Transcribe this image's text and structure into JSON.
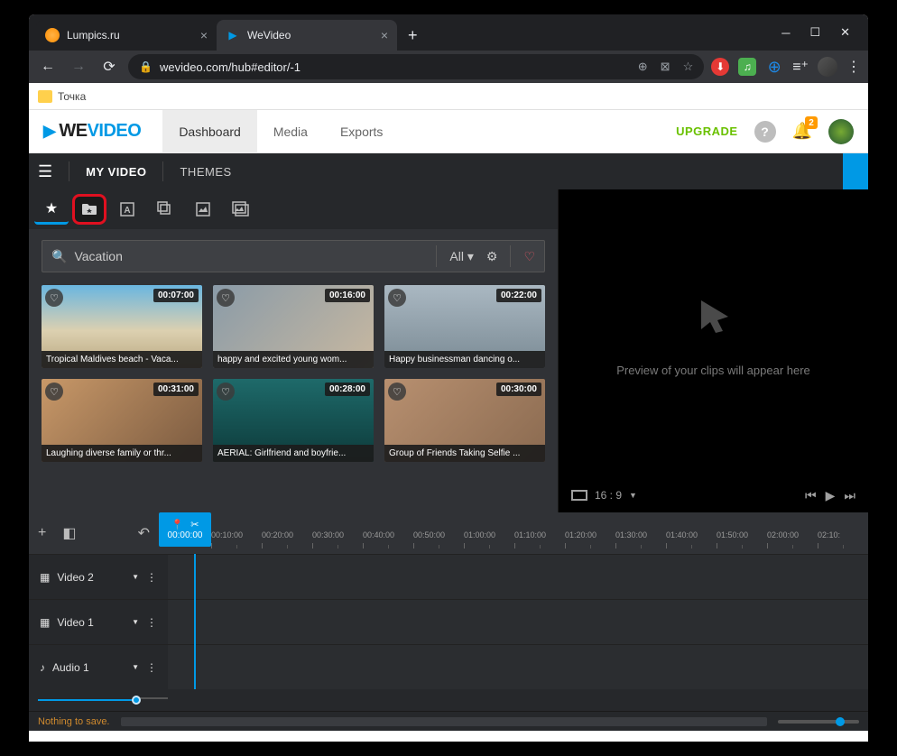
{
  "browser": {
    "tabs": [
      {
        "title": "Lumpics.ru",
        "active": false
      },
      {
        "title": "WeVideo",
        "active": true
      }
    ],
    "url_display": "wevideo.com/hub#editor/-1",
    "bookmark": "Точка"
  },
  "wevideo_nav": {
    "links": [
      "Dashboard",
      "Media",
      "Exports"
    ],
    "active": "Dashboard",
    "upgrade": "UPGRADE",
    "notif_count": "2"
  },
  "editor": {
    "tabs": [
      "MY VIDEO",
      "THEMES"
    ],
    "active": "MY VIDEO"
  },
  "search": {
    "value": "Vacation",
    "filter": "All"
  },
  "clips": [
    {
      "duration": "00:07:00",
      "title": "Tropical Maldives beach - Vaca...",
      "bg": "linear-gradient(180deg,#6ab6e0 0%,#dcd0b0 55%,#b8a680 100%)"
    },
    {
      "duration": "00:16:00",
      "title": "happy and excited young wom...",
      "bg": "linear-gradient(135deg,#8a9ba8,#c8b8a0)"
    },
    {
      "duration": "00:22:00",
      "title": "Happy businessman dancing o...",
      "bg": "linear-gradient(180deg,#aab8c2,#7a8a94)"
    },
    {
      "duration": "00:31:00",
      "title": "Laughing diverse family or thr...",
      "bg": "linear-gradient(135deg,#c89868,#7a5a40)"
    },
    {
      "duration": "00:28:00",
      "title": "AERIAL: Girlfriend and boyfrie...",
      "bg": "linear-gradient(180deg,#1e6a6a,#0d3a3a)"
    },
    {
      "duration": "00:30:00",
      "title": "Group of Friends Taking Selfie ...",
      "bg": "linear-gradient(135deg,#b89070,#8a6a50)"
    }
  ],
  "preview": {
    "placeholder": "Preview of your clips will appear here",
    "aspect": "16 : 9"
  },
  "timeline": {
    "playhead_time": "00:00:00",
    "times": [
      "00:10:00",
      "00:20:00",
      "00:30:00",
      "00:40:00",
      "00:50:00",
      "01:00:00",
      "01:10:00",
      "01:20:00",
      "01:30:00",
      "01:40:00",
      "01:50:00",
      "02:00:00",
      "02:10:"
    ],
    "tracks": [
      {
        "icon": "▦",
        "name": "Video 2"
      },
      {
        "icon": "▦",
        "name": "Video 1"
      },
      {
        "icon": "♪",
        "name": "Audio 1"
      }
    ]
  },
  "status": "Nothing to save."
}
